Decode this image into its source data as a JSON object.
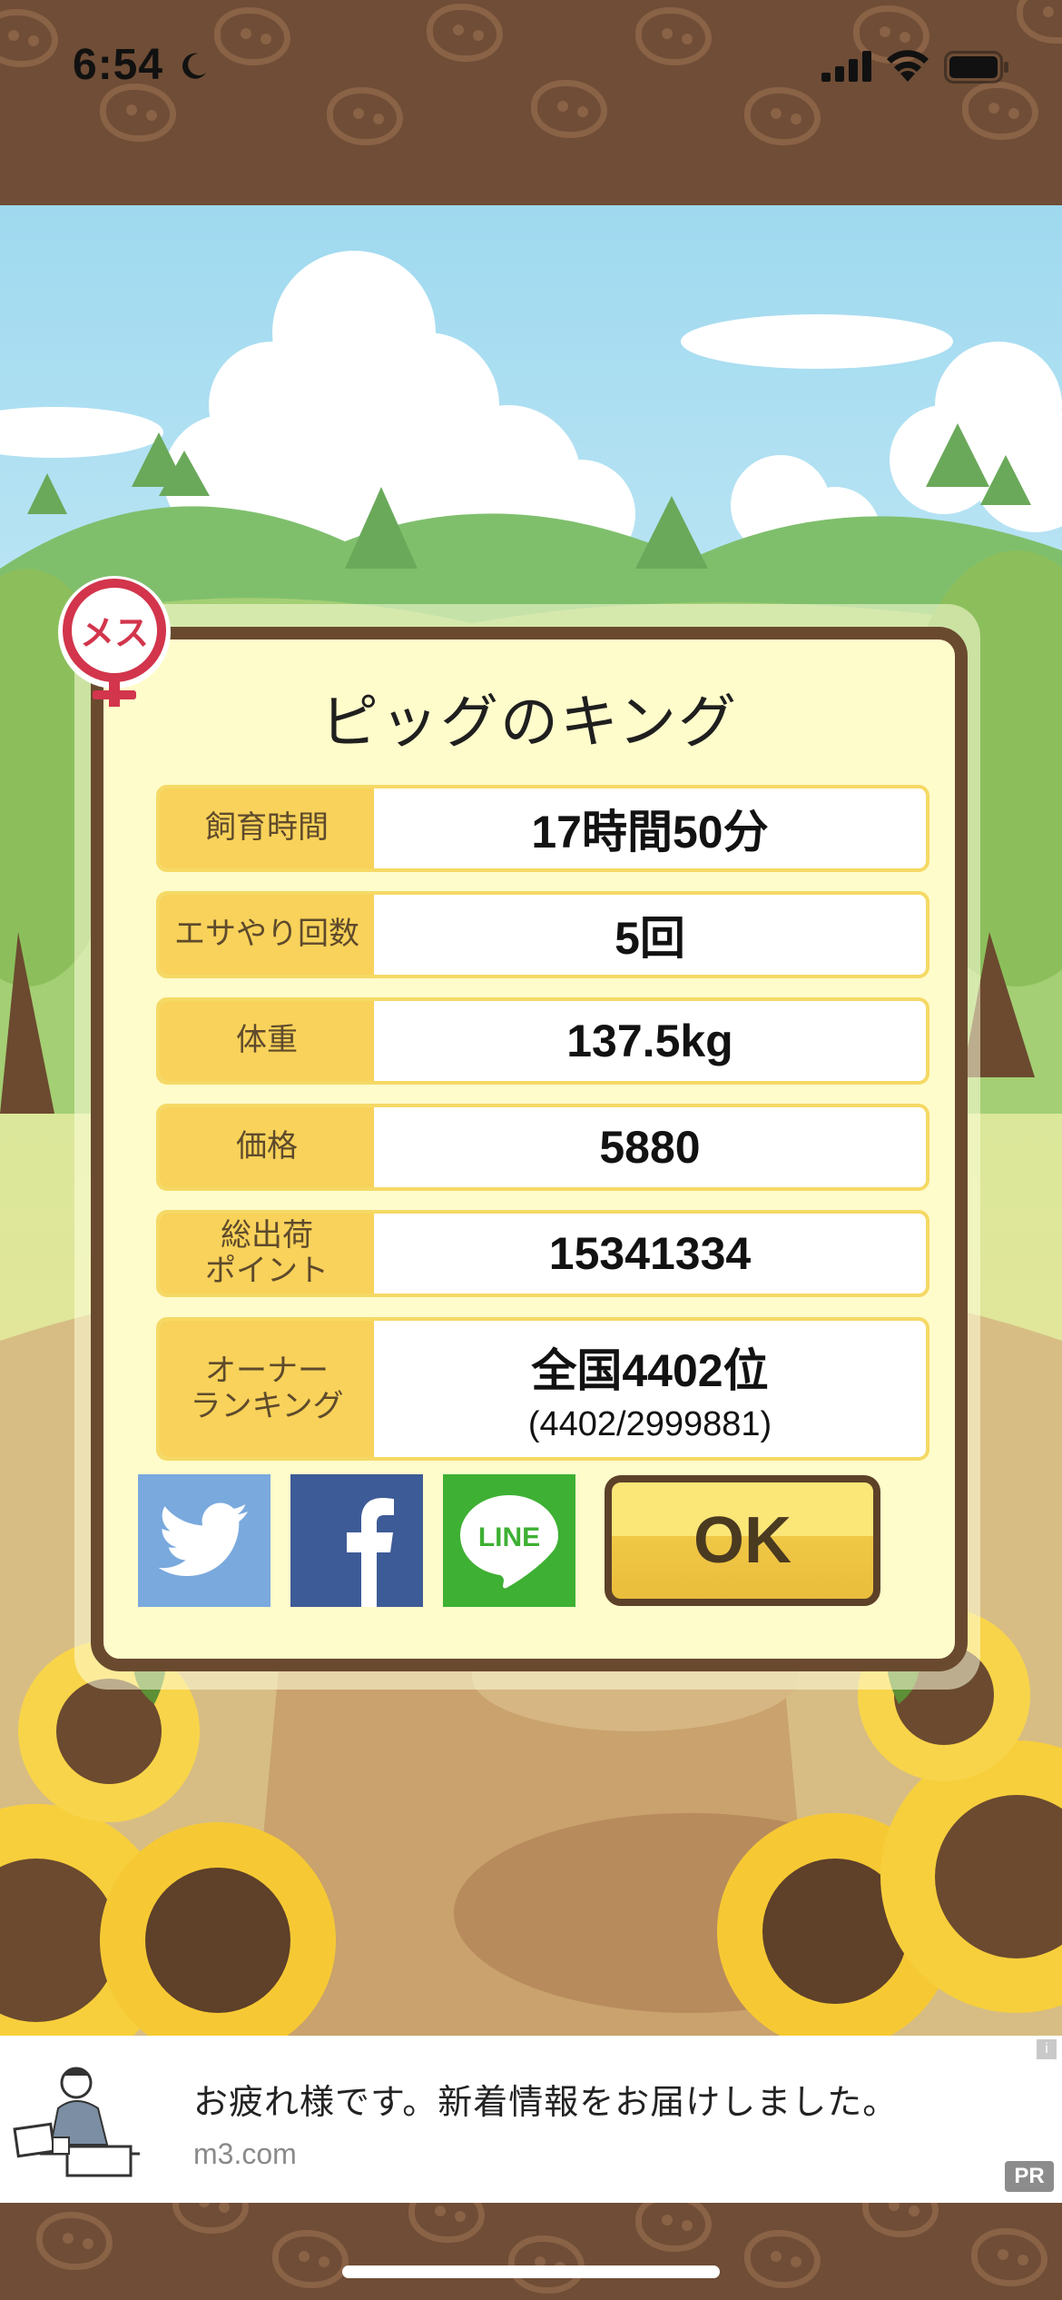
{
  "status_bar": {
    "time": "6:54"
  },
  "dialog": {
    "title": "ピッグのキング",
    "rows": [
      {
        "label": "飼育時間",
        "value": "17時間50分"
      },
      {
        "label": "エサやり回数",
        "value": "5回"
      },
      {
        "label": "体重",
        "value": "137.5kg"
      },
      {
        "label": "価格",
        "value": "5880"
      },
      {
        "label": "総出荷\nポイント",
        "value": "15341334"
      },
      {
        "label": "オーナー\nランキング",
        "value": "全国4402位",
        "sub": "(4402/2999881)"
      }
    ],
    "ok_label": "OK",
    "social": {
      "line_label": "LINE"
    },
    "gender_badge": "メス"
  },
  "ad": {
    "text": "お疲れ様です。新着情報をお届けしました。",
    "host": "m3.com",
    "badge": "PR",
    "info": "i"
  },
  "colors": {
    "label_bg": "#f8d25a",
    "frame": "#6a4a2f",
    "panel_bg": "#fffccb",
    "twitter": "#7aa9dd",
    "facebook": "#3d5b96",
    "line": "#3eb033"
  }
}
